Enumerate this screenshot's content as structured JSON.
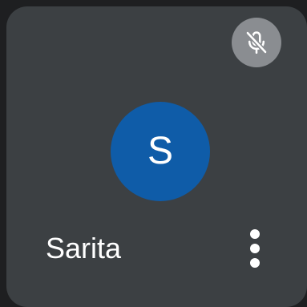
{
  "participant": {
    "name": "Sarita",
    "avatar_initial": "S",
    "avatar_color": "#0f5ca8",
    "mic_status": "muted",
    "mic_icon": "mic-off-icon"
  },
  "tile": {
    "background": "#3c4043",
    "menu_icon": "more-vert-icon"
  }
}
